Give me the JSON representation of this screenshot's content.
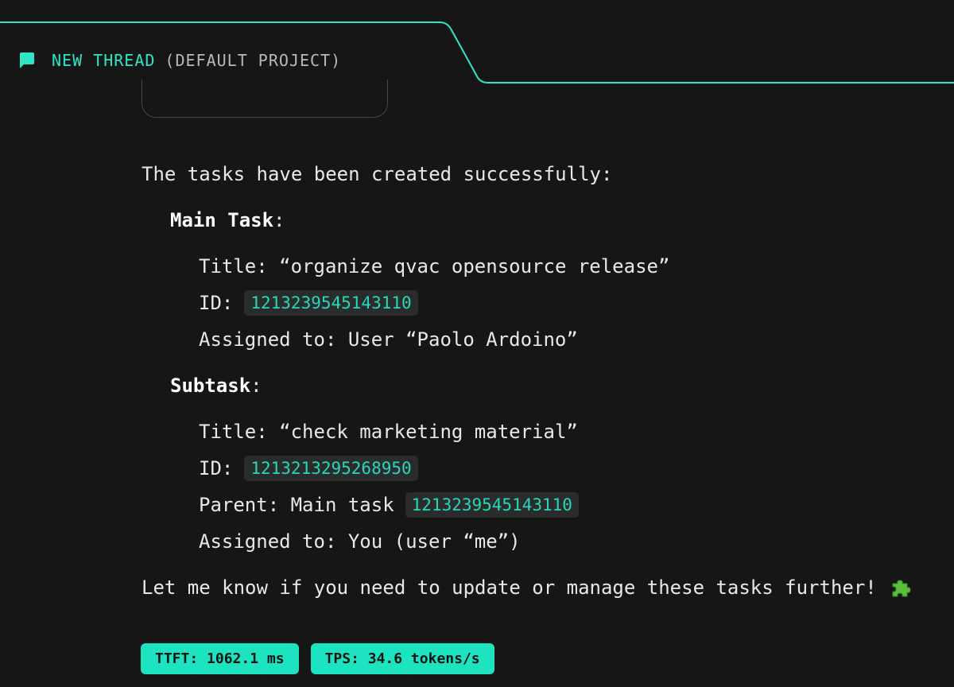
{
  "header": {
    "title": "NEW THREAD",
    "project": "(DEFAULT PROJECT)",
    "icon": "chat-bubble-icon",
    "accent_color": "#2ee6c5"
  },
  "message": {
    "intro": "The tasks have been created successfully:",
    "main_task": {
      "heading": "Main Task",
      "heading_suffix": ":",
      "title_label": "Title: ",
      "title_value": "“organize qvac opensource release”",
      "id_label": "ID:",
      "id_value": "1213239545143110",
      "assigned_label": "Assigned to: ",
      "assigned_value": "User “Paolo Ardoino”"
    },
    "subtask": {
      "heading": "Subtask",
      "heading_suffix": ":",
      "title_label": "Title: ",
      "title_value": "“check marketing material”",
      "id_label": "ID:",
      "id_value": "1213213295268950",
      "parent_label": "Parent: Main task",
      "parent_value": "1213239545143110",
      "assigned_label": "Assigned to: ",
      "assigned_value": "You (user “me”)"
    },
    "outro": "Let me know if you need to update or manage these tasks further!",
    "outro_icon": "puzzle-piece-icon"
  },
  "metrics": {
    "ttft": "TTFT: 1062.1 ms",
    "tps": "TPS: 34.6 tokens/s",
    "badge_color": "#1de3c0"
  }
}
